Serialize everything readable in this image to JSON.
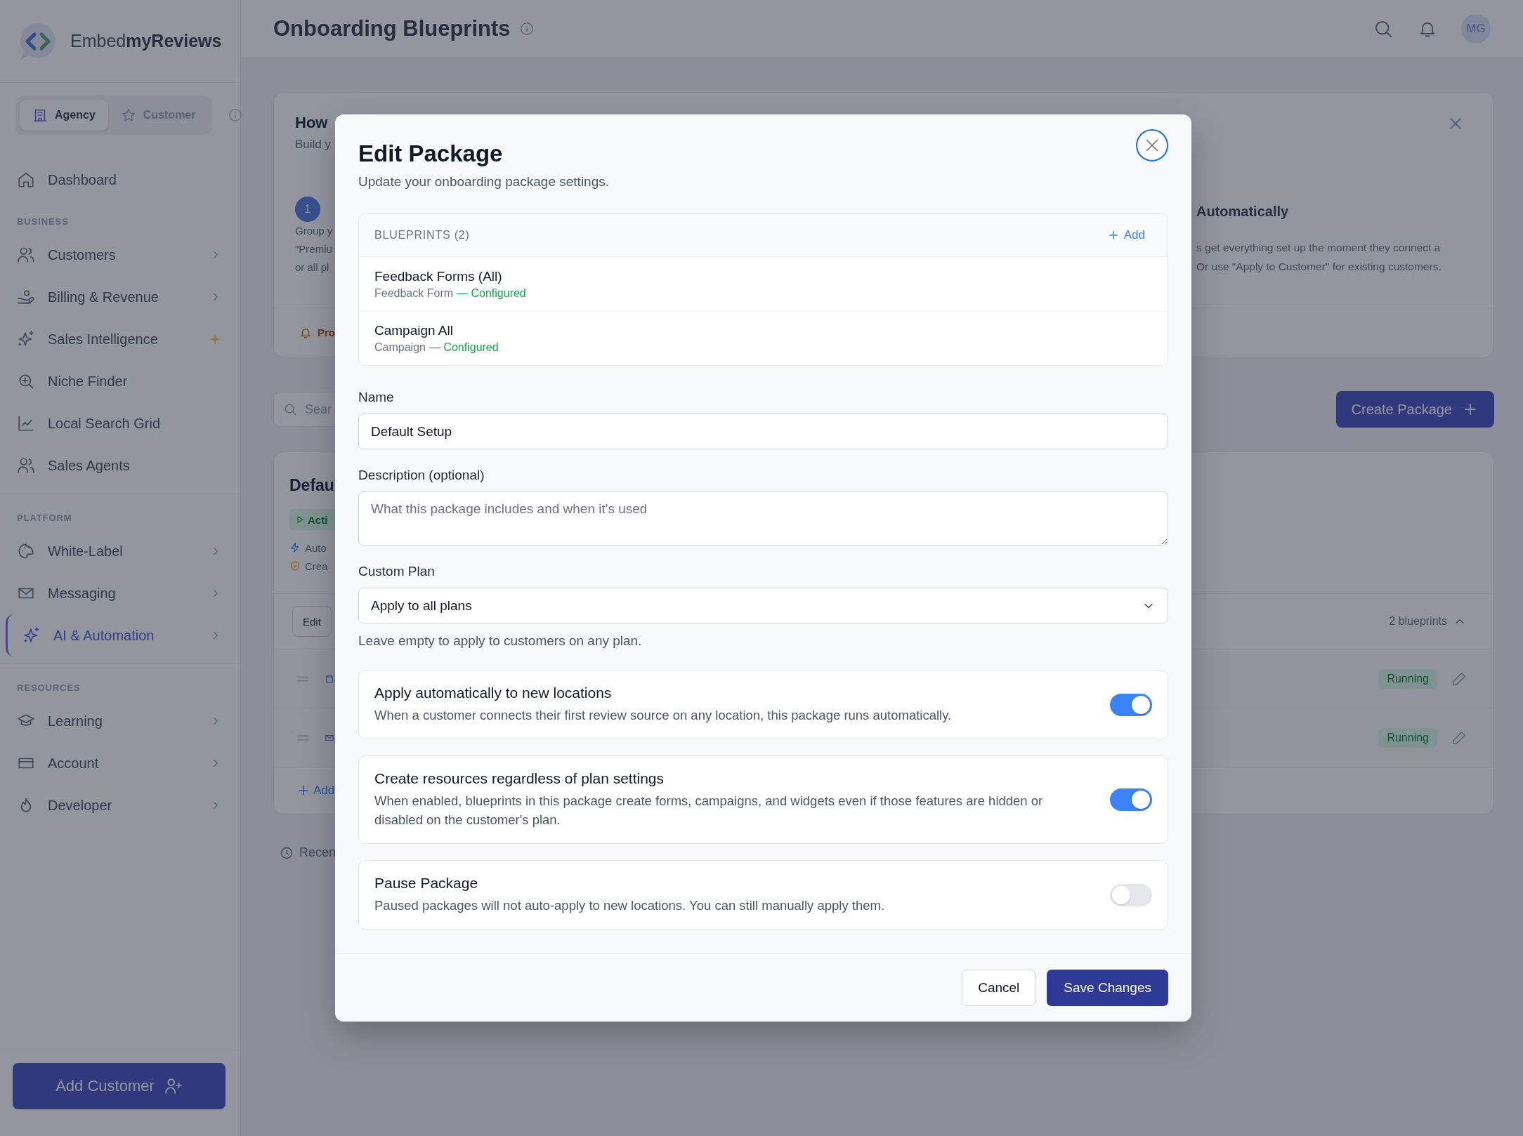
{
  "sidebar": {
    "logo": "Embed**myReviews**",
    "mode_toggle": [
      {
        "label": "Agency",
        "selected": true
      },
      {
        "label": "Customer",
        "selected": false
      }
    ],
    "sections": [
      {
        "items": [
          {
            "label": "Dashboard",
            "selected": false
          }
        ]
      },
      {
        "heading": "BUSINESS",
        "items": [
          {
            "label": "Customers",
            "expandable": true,
            "selected": false
          },
          {
            "label": "Billing & Revenue",
            "expandable": true,
            "selected": false
          },
          {
            "label": "Sales Intelligence",
            "highlighted": true,
            "selected": false
          },
          {
            "label": "Niche Finder",
            "selected": false
          },
          {
            "label": "Local Search Grid",
            "selected": false
          },
          {
            "label": "Sales Agents",
            "selected": false
          }
        ]
      },
      {
        "heading": "PLATFORM",
        "items": [
          {
            "label": "White-Label",
            "expandable": true,
            "selected": false
          },
          {
            "label": "Messaging",
            "expandable": true,
            "selected": false
          },
          {
            "label": "AI & Automation",
            "expandable": true,
            "selected": true
          }
        ]
      },
      {
        "heading": "RESOURCES",
        "items": [
          {
            "label": "Learning",
            "expandable": true,
            "selected": false
          },
          {
            "label": "Account",
            "expandable": true,
            "selected": false
          },
          {
            "label": "Developer",
            "expandable": true,
            "selected": false
          }
        ]
      }
    ],
    "add_button": "Add Customer"
  },
  "header": {
    "title": "Onboarding Blueprints",
    "avatar": "MG"
  },
  "main": {
    "intro_card": {
      "title": "How",
      "subtitle": "Build y",
      "step_number": "1",
      "step_lines": [
        "Group y",
        "\"Premiu",
        "or all pl"
      ],
      "step3_title": "Automatically",
      "step3_lines": [
        "s get everything set up the moment they connect a",
        "Or use \"Apply to Customer\" for existing customers."
      ],
      "footer": "Pro"
    },
    "search": {
      "placeholder": "Sear"
    },
    "create_button": "Create Package",
    "package_card": {
      "title": "Defau",
      "status": "Acti",
      "features": [
        "Auto",
        "Crea"
      ],
      "edit_button": "Edit",
      "blueprint_count": "2 blueprints",
      "expanded": true,
      "blueprints": [
        {
          "status": "Running"
        },
        {
          "status": "Running"
        }
      ],
      "add_button": "Add"
    },
    "recent": "Recen"
  },
  "modal": {
    "title": "Edit Package",
    "subtitle": "Update your onboarding package settings.",
    "blueprints": {
      "heading": "BLUEPRINTS (2)",
      "add_button": "Add",
      "items": [
        {
          "name": "Feedback Forms (All)",
          "type": "Feedback Form",
          "status": "— Configured"
        },
        {
          "name": "Campaign All",
          "type": "Campaign",
          "status": "— Configured"
        }
      ]
    },
    "name_field": {
      "label": "Name",
      "value": "Default Setup"
    },
    "description_field": {
      "label": "Description (optional)",
      "placeholder": "What this package includes and when it's used"
    },
    "plan_field": {
      "label": "Custom Plan",
      "value": "Apply to all plans",
      "hint": "Leave empty to apply to customers on any plan."
    },
    "toggles": [
      {
        "title": "Apply automatically to new locations",
        "description": "When a customer connects their first review source on any location, this package runs automatically.",
        "on": true
      },
      {
        "title": "Create resources regardless of plan settings",
        "description": "When enabled, blueprints in this package create forms, campaigns, and widgets even if those features are hidden or disabled on the customer's plan.",
        "on": true
      },
      {
        "title": "Pause Package",
        "description": "Paused packages will not auto-apply to new locations. You can still manually apply them.",
        "on": false
      }
    ],
    "cancel_button": "Cancel",
    "save_button": "Save Changes"
  }
}
